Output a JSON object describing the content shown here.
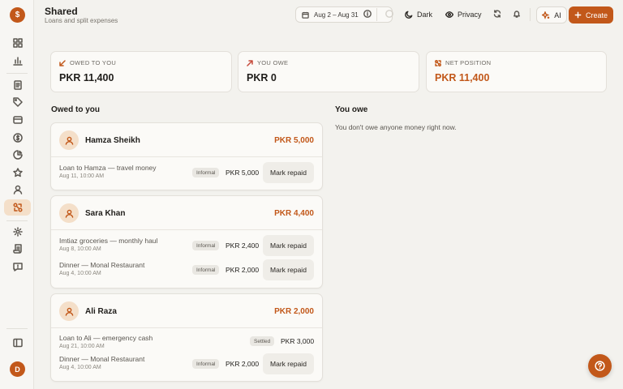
{
  "app": {
    "logo_glyph": "$",
    "user_initial": "D",
    "accent": "#c2581a"
  },
  "sidebar": {
    "items": [
      {
        "icon": "dashboard-icon"
      },
      {
        "icon": "bar-chart-icon"
      },
      {
        "icon": "document-icon"
      },
      {
        "icon": "tag-icon"
      },
      {
        "icon": "wallet-icon"
      },
      {
        "icon": "dollar-circle-icon"
      },
      {
        "icon": "pie-chart-icon"
      },
      {
        "icon": "star-icon"
      },
      {
        "icon": "user-icon"
      },
      {
        "icon": "shared-icon",
        "active": true
      },
      {
        "icon": "settings-icon"
      },
      {
        "icon": "scroll-icon"
      },
      {
        "icon": "feedback-icon"
      },
      {
        "icon": "collapse-sidebar-icon"
      }
    ]
  },
  "header": {
    "title": "Shared",
    "subtitle": "Loans and split expenses",
    "date_range": "Aug 2 – Aug 31",
    "dark_label": "Dark",
    "privacy_label": "Privacy",
    "ai_label": "AI",
    "create_label": "Create"
  },
  "stats": {
    "owed_to_you": {
      "label": "OWED TO YOU",
      "value": "PKR 11,400"
    },
    "you_owe": {
      "label": "YOU OWE",
      "value": "PKR 0"
    },
    "net_position": {
      "label": "NET POSITION",
      "value": "PKR 11,400"
    }
  },
  "owed_section": {
    "title": "Owed to you",
    "repaid_label": "Mark repaid",
    "people": [
      {
        "name": "Hamza Sheikh",
        "total": "PKR 5,000",
        "entries": [
          {
            "description": "Loan to Hamza — travel money",
            "date": "Aug 11, 10:00 AM",
            "status": "Informal",
            "amount": "PKR 5,000",
            "repaid": false
          }
        ]
      },
      {
        "name": "Sara Khan",
        "total": "PKR 4,400",
        "entries": [
          {
            "description": "Imtiaz groceries — monthly haul",
            "date": "Aug 8, 10:00 AM",
            "status": "Informal",
            "amount": "PKR 2,400",
            "repaid": false
          },
          {
            "description": "Dinner — Monal Restaurant",
            "date": "Aug 4, 10:00 AM",
            "status": "Informal",
            "amount": "PKR 2,000",
            "repaid": false
          }
        ]
      },
      {
        "name": "Ali Raza",
        "total": "PKR 2,000",
        "entries": [
          {
            "description": "Loan to Ali — emergency cash",
            "date": "Aug 21, 10:00 AM",
            "status": "Settled",
            "amount": "PKR 3,000",
            "repaid": true
          },
          {
            "description": "Dinner — Monal Restaurant",
            "date": "Aug 4, 10:00 AM",
            "status": "Informal",
            "amount": "PKR 2,000",
            "repaid": false
          }
        ]
      }
    ]
  },
  "you_owe_section": {
    "title": "You owe",
    "empty_text": "You don't owe anyone money right now."
  }
}
